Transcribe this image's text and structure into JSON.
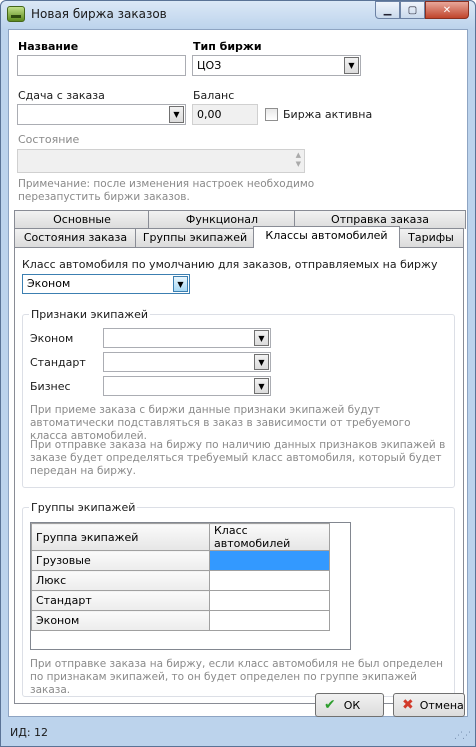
{
  "window": {
    "title": "Новая биржа заказов"
  },
  "form": {
    "name_label": "Название",
    "name_value": "",
    "type_label": "Тип биржи",
    "type_value": "ЦОЗ",
    "change_label": "Сдача с заказа",
    "change_value": "",
    "balance_label": "Баланс",
    "balance_value": "0,00",
    "active_label": "Биржа активна",
    "active_checked": false,
    "state_label": "Состояние",
    "state_value": "",
    "note": "Примечание: после изменения настроек необходимо перезапустить биржи заказов."
  },
  "tabs": {
    "row1": [
      "Основные",
      "Функционал",
      "Отправка заказа"
    ],
    "row2": [
      "Состояния заказа",
      "Группы экипажей",
      "Классы автомобилей",
      "Тарифы"
    ],
    "active": "Классы автомобилей"
  },
  "panel": {
    "default_class_label": "Класс автомобиля по умолчанию для заказов, отправляемых на биржу",
    "default_class_value": "Эконом",
    "crew_signs": {
      "title": "Признаки экипажей",
      "rows": [
        {
          "label": "Эконом",
          "value": ""
        },
        {
          "label": "Стандарт",
          "value": ""
        },
        {
          "label": "Бизнес",
          "value": ""
        }
      ],
      "hint1": "При приеме заказа с биржи данные признаки экипажей будут автоматически подставляться в заказ в зависимости от требуемого класса автомобилей.",
      "hint2": "При отправке заказа на биржу по наличию данных признаков экипажей в заказе будет определяться требуемый класс автомобиля, который будет передан на биржу."
    },
    "crew_groups": {
      "title": "Группы экипажей",
      "columns": [
        "Группа экипажей",
        "Класс автомобилей"
      ],
      "rows": [
        {
          "group": "Грузовые",
          "class": ""
        },
        {
          "group": "Люкс",
          "class": ""
        },
        {
          "group": "Стандарт",
          "class": ""
        },
        {
          "group": "Эконом",
          "class": ""
        }
      ],
      "hint": "При отправке заказа на биржу, если класс автомобиля не был определен по признакам экипажей, то он будет определен по группе экипажей заказа."
    }
  },
  "buttons": {
    "ok": "ОК",
    "cancel": "Отмена"
  },
  "status": {
    "id_text": "ИД: 12"
  },
  "colors": {
    "selection": "#3399ff",
    "frame": "#bcd3ec"
  }
}
